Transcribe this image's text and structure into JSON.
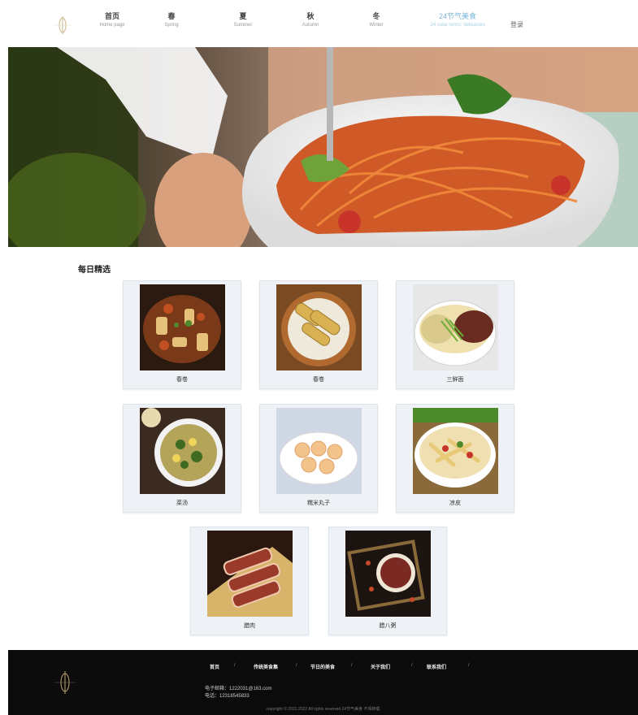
{
  "nav": {
    "items": [
      {
        "zh": "首页",
        "en": "Home page"
      },
      {
        "zh": "春",
        "en": "Spring"
      },
      {
        "zh": "夏",
        "en": "Summer"
      },
      {
        "zh": "秋",
        "en": "Autumn"
      },
      {
        "zh": "冬",
        "en": "Winter"
      },
      {
        "zh": "24节气美食",
        "en": "24 solar terms' delicacies"
      }
    ],
    "login": "登录"
  },
  "section": {
    "title": "每日精选",
    "cards": [
      {
        "name": "春卷"
      },
      {
        "name": "春卷"
      },
      {
        "name": "三鲜面"
      },
      {
        "name": "菜汤"
      },
      {
        "name": "糯米丸子"
      },
      {
        "name": "凉皮"
      },
      {
        "name": "腊肉"
      },
      {
        "name": "腊八粥"
      }
    ]
  },
  "footer": {
    "links": [
      "首页",
      "传统美食集",
      "节日的美食",
      "关于我们",
      "联系我们"
    ],
    "separator": "/",
    "email": "电子邮箱：1222031@163.com",
    "phone": "电话：12318545833",
    "copyright": "copyright © 2021-2022 All rights reserved 24节气美食 不得转载"
  },
  "colors": {
    "accent": "#7ab7d6",
    "footer_bg": "#0b0b0b",
    "card_bg": "#eef2f6"
  }
}
